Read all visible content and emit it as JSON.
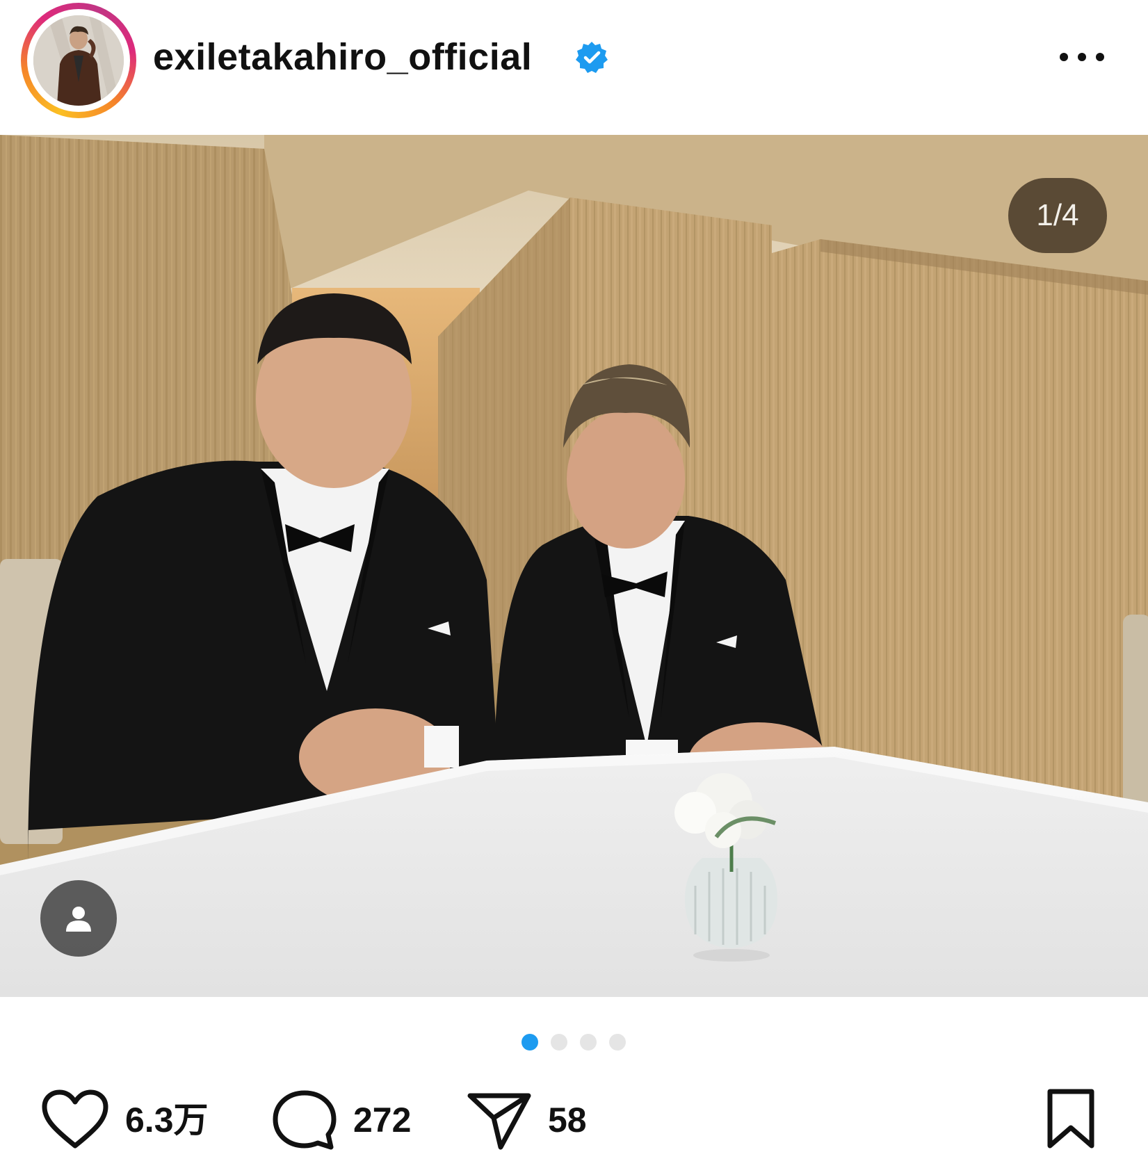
{
  "post": {
    "username": "exiletakahiro_official",
    "verified": true,
    "accent_color": "#1d9bf0"
  },
  "media": {
    "counter": "1/4",
    "total_slides": 4,
    "active_slide": 1
  },
  "icons": {
    "verified": "verified-badge-icon",
    "more": "more-horizontal-icon",
    "tag": "user-tag-icon",
    "like": "heart-icon",
    "comment": "comment-bubble-icon",
    "share": "paper-plane-icon",
    "save": "bookmark-icon"
  },
  "actions": {
    "likes": "6.3万",
    "comments": "272",
    "shares": "58"
  }
}
